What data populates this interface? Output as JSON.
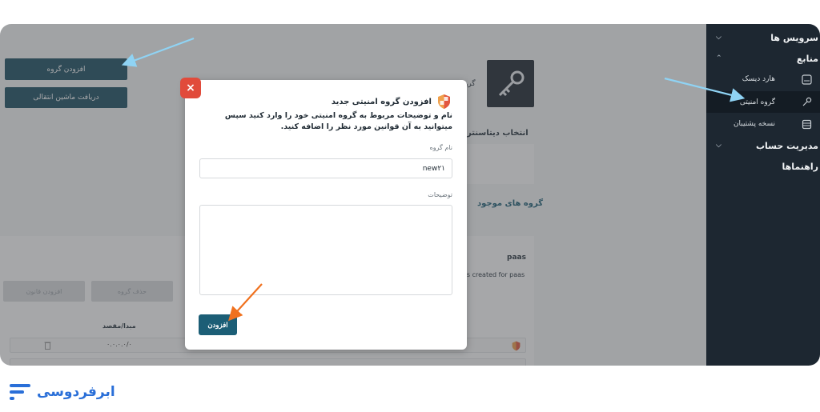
{
  "sidebar": {
    "services_label": "سرویس ها",
    "resources_label": "منابع",
    "hard_disk_label": "هارد دیسک",
    "security_group_label": "گروه امنیتی",
    "backup_label": "نسخه پشتیبان",
    "account_management_label": "مدیریت حساب",
    "guides_label": "راهنماها"
  },
  "background": {
    "add_group_button": "افزودن گروه",
    "get_transfer_vm_button": "دریافت ماشین انتقالی",
    "select_datacenter_title": "انتخاب دیتاسنتر",
    "existing_groups_title": "گروه های موجود",
    "group_name_paas": "paas",
    "group_desc_fragment": "as created for paas",
    "delete_group_button": "حذف گروه",
    "add_rule_button": "افزودن قانون",
    "source_dest_header": "مبدا/مقصد",
    "source_dest_value": "۰.۰.۰.۰/۰",
    "title_fragment": "گرو"
  },
  "modal": {
    "title": "افزودن گروه امنیتی جدید",
    "description": "نام و توضیحات مربوط به گروه امنیتی خود را وارد کنید سپس میتوانید به آن قوانین مورد نظر را اضافه کنید.",
    "group_name_label": "نام گروه",
    "group_name_value": "new۲۱",
    "description_label": "توضیحات",
    "submit_label": "افزودن",
    "close_symbol": "×"
  },
  "brand": {
    "name": "ابرفردوسی"
  },
  "colors": {
    "sidebar_bg": "#1d2731",
    "primary_button": "#1c4f63",
    "close_button": "#e14b3b",
    "arrow_blue": "#8fd3f4",
    "arrow_orange": "#f0711e",
    "brand_blue": "#2a6fd8"
  }
}
